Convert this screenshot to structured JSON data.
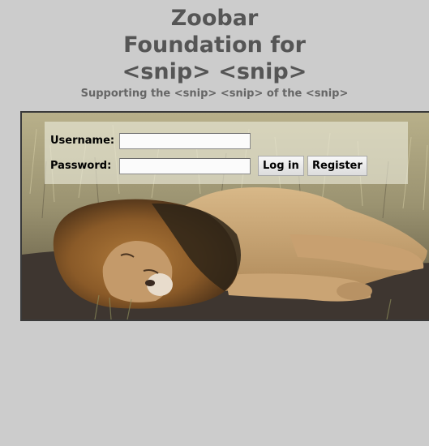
{
  "header": {
    "title_lines": [
      "Zoobar",
      "Foundation for",
      "<snip> <snip>"
    ],
    "subtitle": "Supporting the <snip> <snip> of the <snip>"
  },
  "login": {
    "username_label": "Username:",
    "password_label": "Password:",
    "username_value": "",
    "password_value": "",
    "login_button": "Log in",
    "register_button": "Register"
  },
  "background_image": {
    "subject": "lion lying on ground in savanna grass"
  }
}
